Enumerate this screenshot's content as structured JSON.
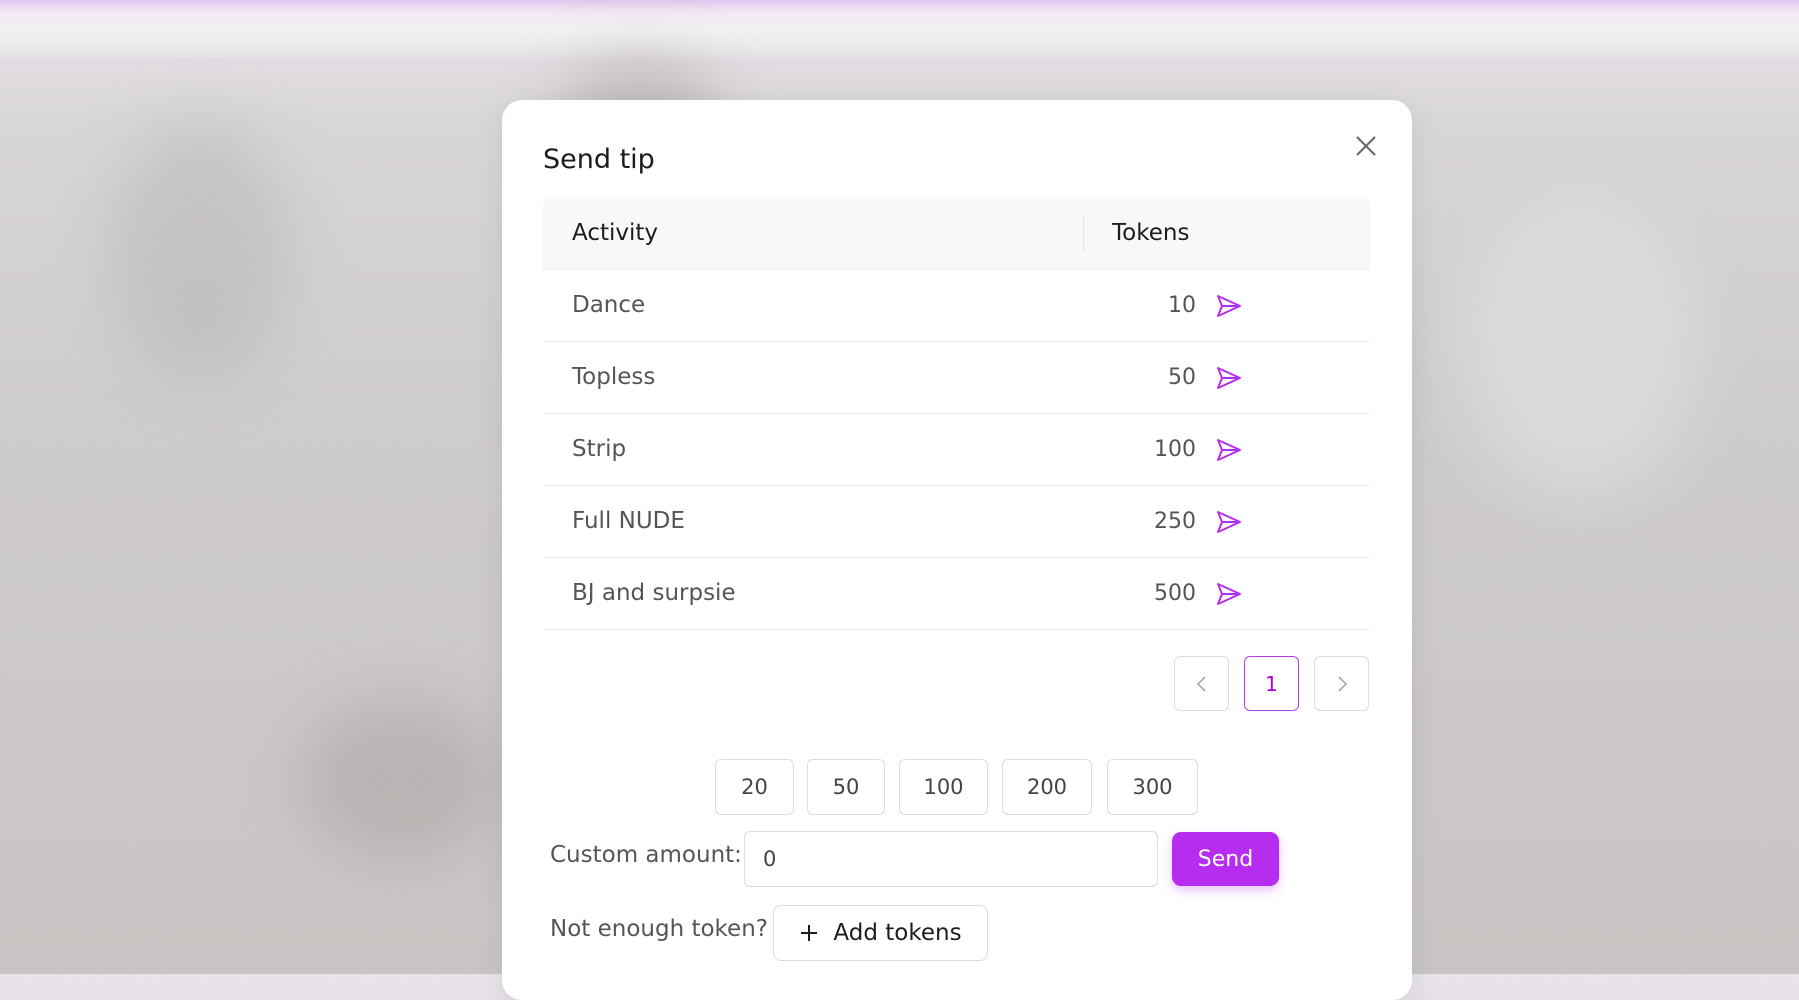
{
  "modal": {
    "title": "Send tip",
    "close_icon": "close-icon"
  },
  "table": {
    "headers": {
      "activity": "Activity",
      "tokens": "Tokens"
    },
    "rows": [
      {
        "activity": "Dance",
        "tokens": "10"
      },
      {
        "activity": "Topless",
        "tokens": "50"
      },
      {
        "activity": "Strip",
        "tokens": "100"
      },
      {
        "activity": "Full NUDE",
        "tokens": "250"
      },
      {
        "activity": "BJ and surpsie",
        "tokens": "500"
      }
    ],
    "row_icon": "send-icon"
  },
  "pagination": {
    "current_page": "1",
    "prev_icon": "chevron-left-icon",
    "next_icon": "chevron-right-icon"
  },
  "amounts": [
    "20",
    "50",
    "100",
    "200",
    "300"
  ],
  "custom": {
    "label": "Custom amount:",
    "value": "0",
    "send_label": "Send"
  },
  "tokens_cta": {
    "question": "Not enough token?",
    "add_label": "Add tokens",
    "add_icon": "plus-icon"
  },
  "colors": {
    "accent": "#b62df0",
    "text": "#1c1c1c",
    "muted": "#555555"
  }
}
